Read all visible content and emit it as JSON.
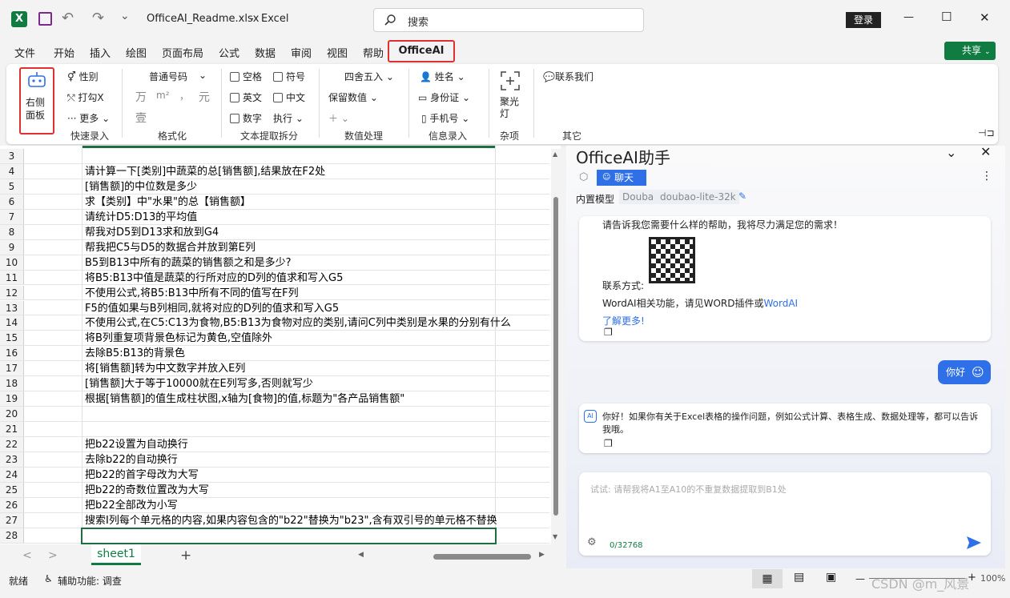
{
  "titlebar": {
    "filename": "OfficeAI_Readme.xlsx",
    "separator": "-",
    "app": "Excel",
    "search_placeholder": "搜索",
    "login": "登录",
    "minimize": "—",
    "maximize": "☐",
    "close": "✕",
    "undo": "↶",
    "redo": "↷",
    "more": "⌄"
  },
  "menu": {
    "items": [
      "文件",
      "开始",
      "插入",
      "绘图",
      "页面布局",
      "公式",
      "数据",
      "审阅",
      "视图",
      "帮助"
    ],
    "active": "OfficeAI",
    "share": "共享"
  },
  "ribbon": {
    "side_panel": "右侧面板",
    "quick": {
      "gender": "性别",
      "tick": "打勾X",
      "more": "更多",
      "group": "快速录入"
    },
    "format": {
      "number_style": "普通号码",
      "wan": "万",
      "m2": "m²",
      "comma": "，",
      "yuan": "元",
      "zhuang": "壹",
      "group": "格式化"
    },
    "text": {
      "space": "空格",
      "symbol": "符号",
      "english": "英文",
      "chinese": "中文",
      "digit": "数字",
      "execute": "执行",
      "group": "文本提取拆分"
    },
    "numbers": {
      "round": "四舍五入",
      "keep_decimal": "保留数值",
      "plus": "＋",
      "group": "数值处理"
    },
    "info": {
      "name": "姓名",
      "id_card": "身份证",
      "phone": "手机号",
      "group": "信息录入"
    },
    "misc": {
      "spotlight": "聚光灯",
      "group": "杂项"
    },
    "other": {
      "contact": "联系我们",
      "group": "其它"
    }
  },
  "rows": [
    {
      "n": "3",
      "t": ""
    },
    {
      "n": "4",
      "t": "请计算一下[类别]中蔬菜的总[销售额],结果放在F2处"
    },
    {
      "n": "5",
      "t": "[销售额]的中位数是多少"
    },
    {
      "n": "6",
      "t": "求【类别】中\"水果\"的总【销售额】"
    },
    {
      "n": "7",
      "t": "请统计D5:D13的平均值"
    },
    {
      "n": "8",
      "t": "帮我对D5到D13求和放到G4"
    },
    {
      "n": "9",
      "t": "帮我把C5与D5的数据合并放到第E列"
    },
    {
      "n": "10",
      "t": "B5到B13中所有的蔬菜的销售额之和是多少?"
    },
    {
      "n": "11",
      "t": "将B5:B13中值是蔬菜的行所对应的D列的值求和写入G5"
    },
    {
      "n": "12",
      "t": "不使用公式,将B5:B13中所有不同的值写在F列"
    },
    {
      "n": "13",
      "t": "F5的值如果与B列相同,就将对应的D列的值求和写入G5"
    },
    {
      "n": "14",
      "t": "不使用公式,在C5:C13为食物,B5:B13为食物对应的类别,请问C列中类别是水果的分别有什么"
    },
    {
      "n": "15",
      "t": "将B列重复项背景色标记为黄色,空值除外"
    },
    {
      "n": "16",
      "t": "去除B5:B13的背景色"
    },
    {
      "n": "17",
      "t": "将[销售额]转为中文数字并放入E列"
    },
    {
      "n": "18",
      "t": "[销售额]大于等于10000就在E列写多,否则就写少"
    },
    {
      "n": "19",
      "t": "根据[销售额]的值生成柱状图,x轴为[食物]的值,标题为\"各产品销售额\""
    },
    {
      "n": "20",
      "t": ""
    },
    {
      "n": "21",
      "t": ""
    },
    {
      "n": "22",
      "t": "把b22设置为自动换行"
    },
    {
      "n": "23",
      "t": "去除b22的自动换行"
    },
    {
      "n": "24",
      "t": "把b22的首字母改为大写"
    },
    {
      "n": "25",
      "t": "把b22的奇数位置改为大写"
    },
    {
      "n": "26",
      "t": "把b22全部改为小写"
    },
    {
      "n": "27",
      "t": "搜索I列每个单元格的内容,如果内容包含的\"b22\"替换为\"b23\",含有双引号的单元格不替换"
    },
    {
      "n": "28",
      "t": ""
    }
  ],
  "sheet": {
    "tab": "sheet1",
    "add": "+",
    "prev": "<",
    "next": ">"
  },
  "status": {
    "ready": "就绪",
    "accessibility": "辅助功能: 调查",
    "zoom_minus": "—",
    "zoom_plus": "+",
    "zoom": "100%",
    "watermark": "CSDN @m_风景"
  },
  "panel": {
    "title": "OfficeAI助手",
    "chat_tab": "聊天",
    "model_label": "内置模型",
    "model_provider": "Douba",
    "model_name": "doubao-lite-32k",
    "msg1": {
      "text": "请告诉我您需要什么样的帮助，我将尽力满足您的需求！",
      "contact": "联系方式:",
      "wordai_prefix": "WordAI相关功能，请见WORD插件或",
      "wordai_link": "WordAI",
      "learn_more": "了解更多!"
    },
    "user_msg": "你好",
    "ai_reply": "你好！如果你有关于Excel表格的操作问题，例如公式计算、表格生成、数据处理等，都可以告诉我哦。",
    "ai_badge": "AI",
    "input_placeholder": "试试: 请帮我将A1至A10的不重复数据提取到B1处",
    "counter": "0/32768"
  },
  "colors": {
    "excel_green": "#107c41",
    "accent_blue": "#2f6fe8",
    "highlight_red": "#e03030"
  }
}
